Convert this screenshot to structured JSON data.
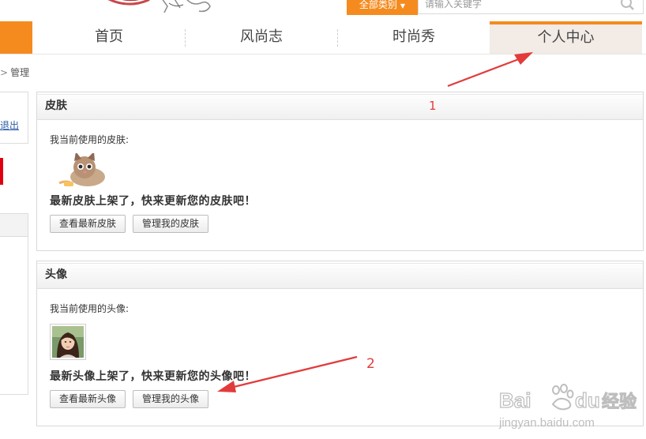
{
  "header": {
    "category_button": "全部类别",
    "search_placeholder": "请输入关键字"
  },
  "nav": {
    "tabs": [
      {
        "label": "首页"
      },
      {
        "label": "风尚志"
      },
      {
        "label": "时尚秀"
      },
      {
        "label": "个人中心",
        "active": true
      }
    ]
  },
  "breadcrumb": {
    "current": "管理"
  },
  "sidebar": {
    "logout_label": "退出"
  },
  "skin_panel": {
    "title": "皮肤",
    "current_label": "我当前使用的皮肤:",
    "promo": "最新皮肤上架了，快来更新您的皮肤吧！",
    "buttons": [
      "查看最新皮肤",
      "管理我的皮肤"
    ]
  },
  "avatar_panel": {
    "title": "头像",
    "current_label": "我当前使用的头像:",
    "promo": "最新头像上架了，快来更新您的头像吧！",
    "buttons": [
      "查看最新头像",
      "管理我的头像"
    ]
  },
  "annotations": {
    "step1": "1",
    "step2": "2"
  },
  "watermark": {
    "brand_a": "Bai",
    "brand_b": "du",
    "brand_c": "经验",
    "url": "jingyan.baidu.com"
  },
  "colors": {
    "accent": "#f58b1f",
    "annotation": "#e23b3b",
    "link": "#2b5ca8"
  }
}
